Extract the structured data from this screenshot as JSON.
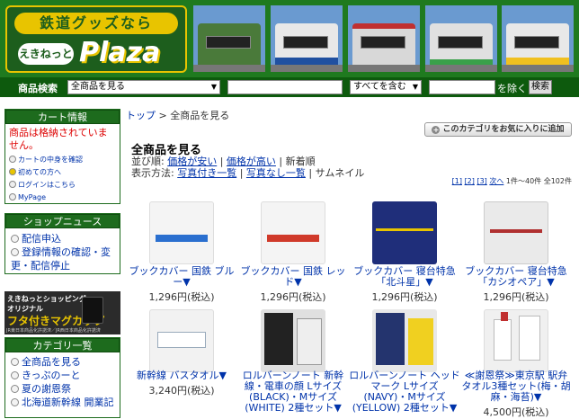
{
  "header": {
    "logo_line1": "鉄道グッズなら",
    "logo_line2": "えきねっと",
    "logo_line3": "Plaza"
  },
  "search": {
    "label": "商品検索",
    "category": "全商品を見る",
    "mode": "すべてを含む",
    "exclude_label": "を除く",
    "button": "検索"
  },
  "sidebar": {
    "cart_title": "カート情報",
    "cart_empty": "商品は格納されていません。",
    "cart_links": [
      "カートの中身を確認",
      "初めての方へ",
      "ログインはこちら",
      "MyPage"
    ],
    "news_title": "ショップニュース",
    "news_items": [
      "配信申込",
      "登録情報の確認・変更・配信停止"
    ],
    "banner_line1": "えきねっとショッピング",
    "banner_line2": "オリジナル",
    "banner_line3": "フタ付きマグカップ",
    "banner_line4": "JR東日本商品化許諾済／JR西日本商品化許諾済",
    "category_title": "カテゴリ一覧",
    "categories": [
      "全商品を見る",
      "きっぷのーと",
      "夏の謝恩祭",
      "北海道新幹線 開業記"
    ]
  },
  "main": {
    "breadcrumb_home": "トップ",
    "breadcrumb_sep": ">",
    "breadcrumb_current": "全商品を見る",
    "fav_button": "このカテゴリをお気に入りに追加",
    "title": "全商品を見る",
    "sort_label": "並び順:",
    "sort_options": [
      "価格が安い",
      "価格が高い",
      "新着順"
    ],
    "view_label": "表示方法:",
    "view_options": [
      "写真付き一覧",
      "写真なし一覧",
      "サムネイル"
    ],
    "pager": {
      "pages": [
        "[1]",
        "[2]",
        "[3]"
      ],
      "next": "次へ",
      "range": "1件～40件",
      "total": "全102件"
    }
  },
  "products": [
    {
      "name": "ブックカバー 国鉄 ブルー▼",
      "price": "1,296円(税込)",
      "color": "#2a6fcf"
    },
    {
      "name": "ブックカバー 国鉄 レッド▼",
      "price": "1,296円(税込)",
      "color": "#d03a2a"
    },
    {
      "name": "ブックカバー 寝台特急「北斗星」▼",
      "price": "1,296円(税込)",
      "color": "#1f2e7a"
    },
    {
      "name": "ブックカバー 寝台特急「カシオペア」▼",
      "price": "1,296円(税込)",
      "color": "#d0d0d0"
    },
    {
      "name": "新幹線 バスタオル▼",
      "price": "3,240円(税込)",
      "color": "#e0e0e0"
    },
    {
      "name": "ロルバーンノート 新幹線・電車の顔 Lサイズ(BLACK)・Mサイズ(WHITE) 2種セット▼",
      "price": "",
      "color": "#333333"
    },
    {
      "name": "ロルバーンノート ヘッドマーク Lサイズ(NAVY)・Mサイズ(YELLOW) 2種セット▼",
      "price": "",
      "color": "#24346e"
    },
    {
      "name": "≪謝恩祭≫東京駅 駅弁タオル3種セット(梅・胡麻・海苔)▼",
      "price": "4,500円(税込)",
      "color": "#f0f0f0"
    }
  ]
}
